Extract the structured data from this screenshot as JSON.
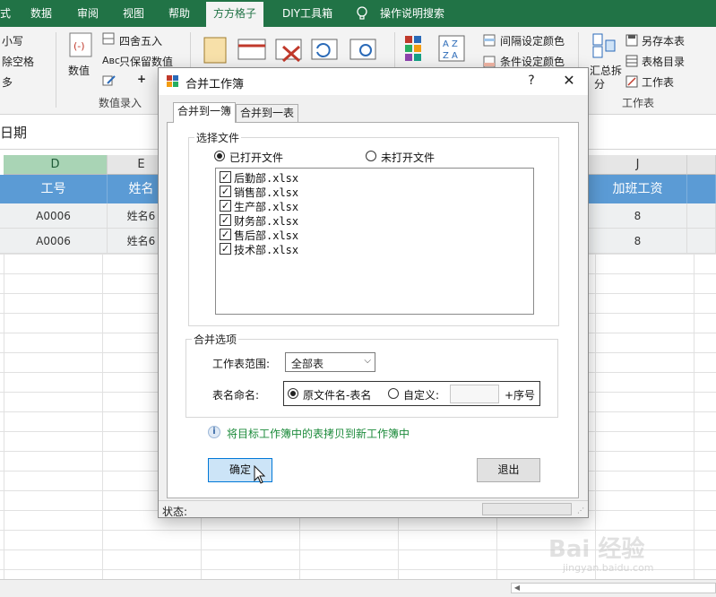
{
  "ribbon_tabs": [
    "式",
    "数据",
    "审阅",
    "视图",
    "帮助",
    "方方格子",
    "DIY工具箱",
    "操作说明搜索"
  ],
  "active_tab": "方方格子",
  "ribbon": {
    "g1": [
      "小写",
      "除空格",
      "多"
    ],
    "g2": [
      "数值",
      "四舍五入",
      "只保留数值",
      "数值录入"
    ],
    "right_mid": [
      "间隔设定颜色",
      "条件设定颜色"
    ],
    "right_big": [
      "汇总拆",
      "分"
    ],
    "right_items": [
      "另存本表",
      "表格目录",
      "工作表",
      "工作表"
    ],
    "small_marks": [
      "Aʙᴄ",
      "+"
    ]
  },
  "formula_text": "日期",
  "columns": [
    "D",
    "E",
    "J"
  ],
  "headers": [
    "工号",
    "姓名",
    "加班工资"
  ],
  "rows": [
    [
      "A0006",
      "姓名6",
      "8"
    ],
    [
      "A0006",
      "姓名6",
      "8"
    ]
  ],
  "dialog": {
    "title": "合并工作簿",
    "help": "?",
    "close": "✕",
    "tabs": [
      "合并到一簿",
      "合并到一表"
    ],
    "select_group_title": "选择文件",
    "radio_opened": "已打开文件",
    "radio_unopened": "未打开文件",
    "files": [
      "后勤部.xlsx",
      "销售部.xlsx",
      "生产部.xlsx",
      "财务部.xlsx",
      "售后部.xlsx",
      "技术部.xlsx"
    ],
    "checkmark": "✓",
    "options_group_title": "合并选项",
    "range_label": "工作表范围:",
    "range_value": "全部表",
    "range_arrow": "⌵",
    "naming_label": "表名命名:",
    "naming_opt1": "原文件名-表名",
    "naming_opt2": "自定义:",
    "naming_suffix": "+序号",
    "info_icon": "i",
    "info_text": "将目标工作簿中的表拷贝到新工作簿中",
    "ok": "确定",
    "exit": "退出",
    "status": "状态:",
    "grip": "⋰"
  },
  "watermark": "Bai 经验",
  "watermark_sub": "jingyan.baidu.com",
  "scroll_arrow": "◀"
}
